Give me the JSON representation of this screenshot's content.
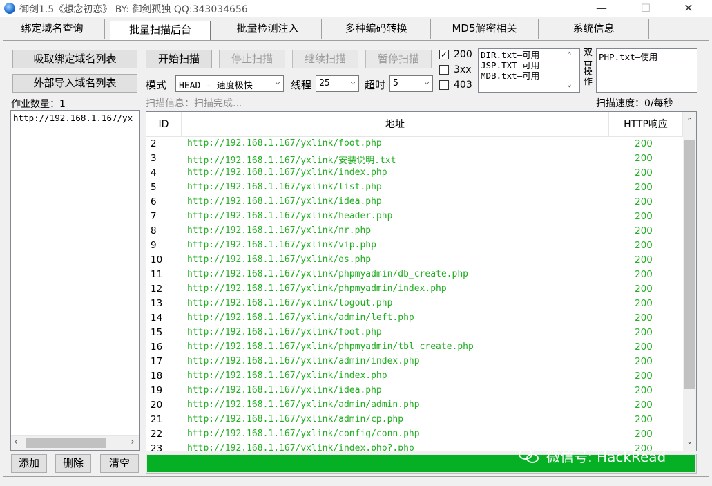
{
  "window": {
    "title": "御剑1.5《想念初恋》  BY:  御剑孤独  QQ:343034656",
    "minimize_glyph": "—",
    "maximize_glyph": "☐",
    "close_glyph": "✕"
  },
  "tabs": [
    {
      "label": "绑定域名查询"
    },
    {
      "label": "批量扫描后台"
    },
    {
      "label": "批量检测注入"
    },
    {
      "label": "多种编码转换"
    },
    {
      "label": "MD5解密相关"
    },
    {
      "label": "系统信息"
    }
  ],
  "left_panel": {
    "btn_fetch": "吸取绑定域名列表",
    "btn_import": "外部导入域名列表",
    "job_count_label": "作业数量：1",
    "domain_list": [
      "http://192.168.1.167/yx"
    ],
    "btn_add": "添加",
    "btn_delete": "删除",
    "btn_clear": "清空"
  },
  "controls": {
    "btn_start": "开始扫描",
    "btn_stop": "停止扫描",
    "btn_continue": "继续扫描",
    "btn_pause": "暂停扫描",
    "mode_label": "模式",
    "mode_value": "HEAD - 速度极快",
    "threads_label": "线程",
    "threads_value": "25",
    "timeout_label": "超时",
    "timeout_value": "5",
    "checkboxes": [
      {
        "label": "200",
        "checked": true
      },
      {
        "label": "3xx",
        "checked": false
      },
      {
        "label": "403",
        "checked": false
      }
    ],
    "dict_list": [
      "DIR.txt—可用",
      "JSP.TXT—可用",
      "MDB.txt—可用"
    ],
    "dblclick_hint": "双击操作",
    "selected_dict": "PHP.txt—使用",
    "scan_info": "扫描信息：扫描完成...",
    "scan_speed": "扫描速度：0/每秒",
    "check_glyph": "✓",
    "arrow_glyph": "⌵"
  },
  "grid": {
    "columns": [
      "ID",
      "地址",
      "HTTP响应"
    ],
    "rows": [
      {
        "id": "2",
        "url": "http://192.168.1.167/yxlink/foot.php",
        "code": "200"
      },
      {
        "id": "3",
        "url": "http://192.168.1.167/yxlink/安装说明.txt",
        "code": "200"
      },
      {
        "id": "4",
        "url": "http://192.168.1.167/yxlink/index.php",
        "code": "200"
      },
      {
        "id": "5",
        "url": "http://192.168.1.167/yxlink/list.php",
        "code": "200"
      },
      {
        "id": "6",
        "url": "http://192.168.1.167/yxlink/idea.php",
        "code": "200"
      },
      {
        "id": "7",
        "url": "http://192.168.1.167/yxlink/header.php",
        "code": "200"
      },
      {
        "id": "8",
        "url": "http://192.168.1.167/yxlink/nr.php",
        "code": "200"
      },
      {
        "id": "9",
        "url": "http://192.168.1.167/yxlink/vip.php",
        "code": "200"
      },
      {
        "id": "10",
        "url": "http://192.168.1.167/yxlink/os.php",
        "code": "200"
      },
      {
        "id": "11",
        "url": "http://192.168.1.167/yxlink/phpmyadmin/db_create.php",
        "code": "200"
      },
      {
        "id": "12",
        "url": "http://192.168.1.167/yxlink/phpmyadmin/index.php",
        "code": "200"
      },
      {
        "id": "13",
        "url": "http://192.168.1.167/yxlink/logout.php",
        "code": "200"
      },
      {
        "id": "14",
        "url": "http://192.168.1.167/yxlink/admin/left.php",
        "code": "200"
      },
      {
        "id": "15",
        "url": "http://192.168.1.167/yxlink/foot.php",
        "code": "200"
      },
      {
        "id": "16",
        "url": "http://192.168.1.167/yxlink/phpmyadmin/tbl_create.php",
        "code": "200"
      },
      {
        "id": "17",
        "url": "http://192.168.1.167/yxlink/admin/index.php",
        "code": "200"
      },
      {
        "id": "18",
        "url": "http://192.168.1.167/yxlink/index.php",
        "code": "200"
      },
      {
        "id": "19",
        "url": "http://192.168.1.167/yxlink/idea.php",
        "code": "200"
      },
      {
        "id": "20",
        "url": "http://192.168.1.167/yxlink/admin/admin.php",
        "code": "200"
      },
      {
        "id": "21",
        "url": "http://192.168.1.167/yxlink/admin/cp.php",
        "code": "200"
      },
      {
        "id": "22",
        "url": "http://192.168.1.167/yxlink/config/conn.php",
        "code": "200"
      },
      {
        "id": "23",
        "url": "http://192.168.1.167/yxlink/index.php?.php",
        "code": "200"
      }
    ]
  },
  "progress": {
    "fraction": 1.0
  },
  "watermark": {
    "text": "微信号: HackRead"
  },
  "colors": {
    "url_green": "#1fae1f",
    "progress_green": "#06b025"
  }
}
